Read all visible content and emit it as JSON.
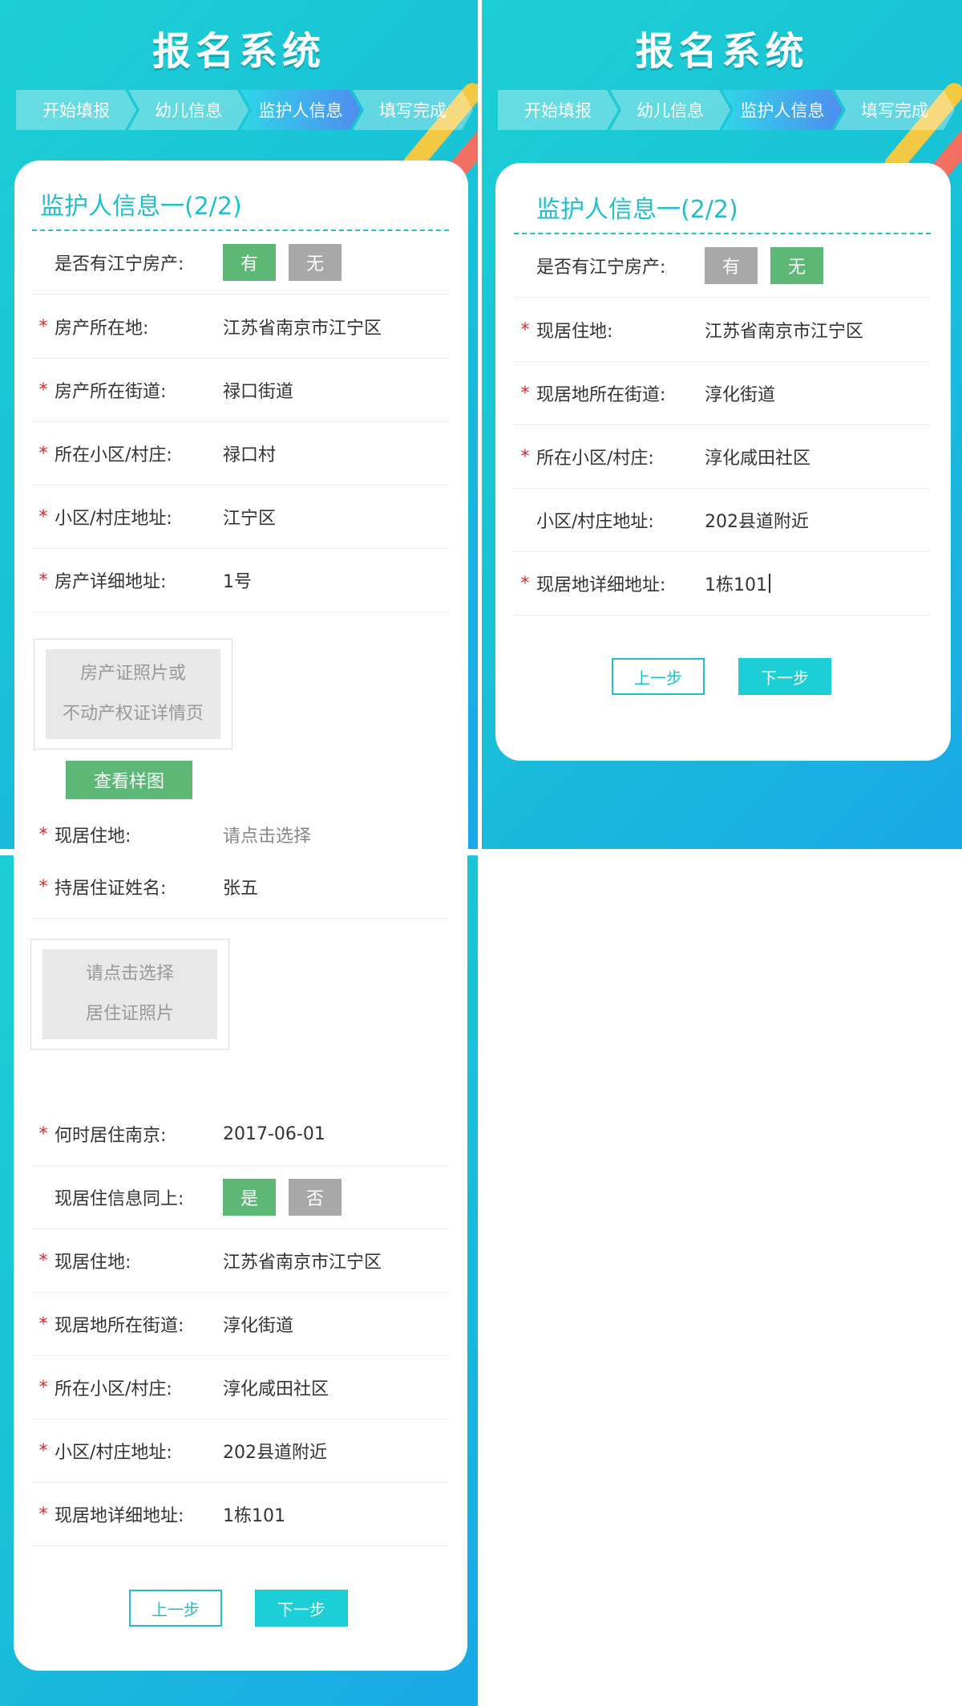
{
  "app_title": "报名系统",
  "steps": [
    "开始填报",
    "幼儿信息",
    "监护人信息",
    "填写完成"
  ],
  "section_title": "监护人信息一(2/2)",
  "colors": {
    "accent": "#1ec0cf",
    "green": "#5db875",
    "gray": "#a8a8a8",
    "required": "#e0242b"
  },
  "panel1": {
    "property_question": "是否有江宁房产:",
    "toggle_yes": "有",
    "toggle_no": "无",
    "selected": "有",
    "rows": [
      {
        "label": "房产所在地:",
        "value": "江苏省南京市江宁区"
      },
      {
        "label": "房产所在街道:",
        "value": "禄口街道"
      },
      {
        "label": "所在小区/村庄:",
        "value": "禄口村"
      },
      {
        "label": "小区/村庄地址:",
        "value": "江宁区"
      },
      {
        "label": "房产详细地址:",
        "value": "1号"
      }
    ],
    "upload_line1": "房产证照片或",
    "upload_line2": "不动产权证详情页",
    "sample_button": "查看样图",
    "residence_label": "现居住地:",
    "residence_placeholder": "请点击选择"
  },
  "panel2": {
    "property_question": "是否有江宁房产:",
    "toggle_yes": "有",
    "toggle_no": "无",
    "selected": "无",
    "rows": [
      {
        "label": "现居住地:",
        "value": "江苏省南京市江宁区"
      },
      {
        "label": "现居地所在街道:",
        "value": "淳化街道"
      },
      {
        "label": "所在小区/村庄:",
        "value": "淳化咸田社区"
      },
      {
        "label": "小区/村庄地址:",
        "value": "202县道附近"
      },
      {
        "label": "现居地详细地址:",
        "value": "1栋101"
      }
    ],
    "prev": "上一步",
    "next": "下一步"
  },
  "panel3": {
    "permit_name_label": "持居住证姓名:",
    "permit_name_value": "张五",
    "upload_line1": "请点击选择",
    "upload_line2": "居住证照片",
    "since_label": "何时居住南京:",
    "since_value": "2017-06-01",
    "same_label": "现居住信息同上:",
    "same_yes": "是",
    "same_no": "否",
    "rows": [
      {
        "label": "现居住地:",
        "value": "江苏省南京市江宁区"
      },
      {
        "label": "现居地所在街道:",
        "value": "淳化街道"
      },
      {
        "label": "所在小区/村庄:",
        "value": "淳化咸田社区"
      },
      {
        "label": "小区/村庄地址:",
        "value": "202县道附近"
      },
      {
        "label": "现居地详细地址:",
        "value": "1栋101"
      }
    ],
    "prev": "上一步",
    "next": "下一步"
  }
}
